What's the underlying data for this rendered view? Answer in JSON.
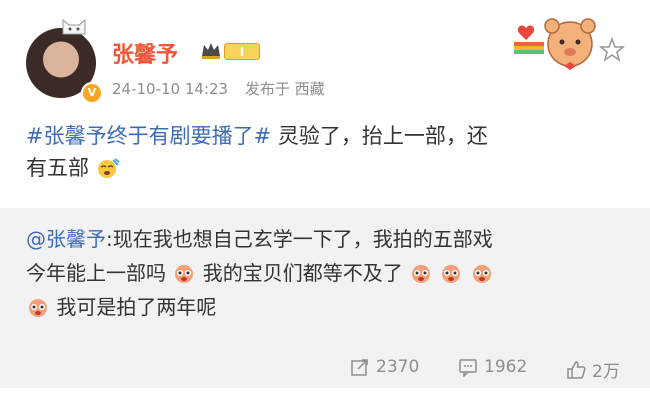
{
  "post": {
    "username": "张馨予",
    "level": "I",
    "timestamp": "24-10-10 14:23",
    "location": "发布于 西藏",
    "topic": "#张馨予终于有剧要播了#",
    "text_line1": " 灵验了，抬上一部，还",
    "text_line2": "有五部"
  },
  "repost": {
    "mention": "@张馨予",
    "text1": ":现在我也想自己玄学一下了，我拍的五部戏",
    "text2": "今年能上一部吗",
    "text3": " 我的宝贝们都等不及了",
    "text4": " 我可是拍了两年呢"
  },
  "actions": {
    "repost_count": "2370",
    "comment_count": "1962",
    "like_count": "2万"
  },
  "colors": {
    "accent": "#f0563a",
    "link": "#3f6bb5",
    "meta": "#8e8e8e"
  },
  "icons": [
    "cat-icon",
    "verified-badge-icon",
    "crown-icon",
    "bear-decoration-icon",
    "star-icon",
    "cool-emoji-icon",
    "cry-emoji-icon",
    "share-icon",
    "comment-icon",
    "like-icon"
  ]
}
